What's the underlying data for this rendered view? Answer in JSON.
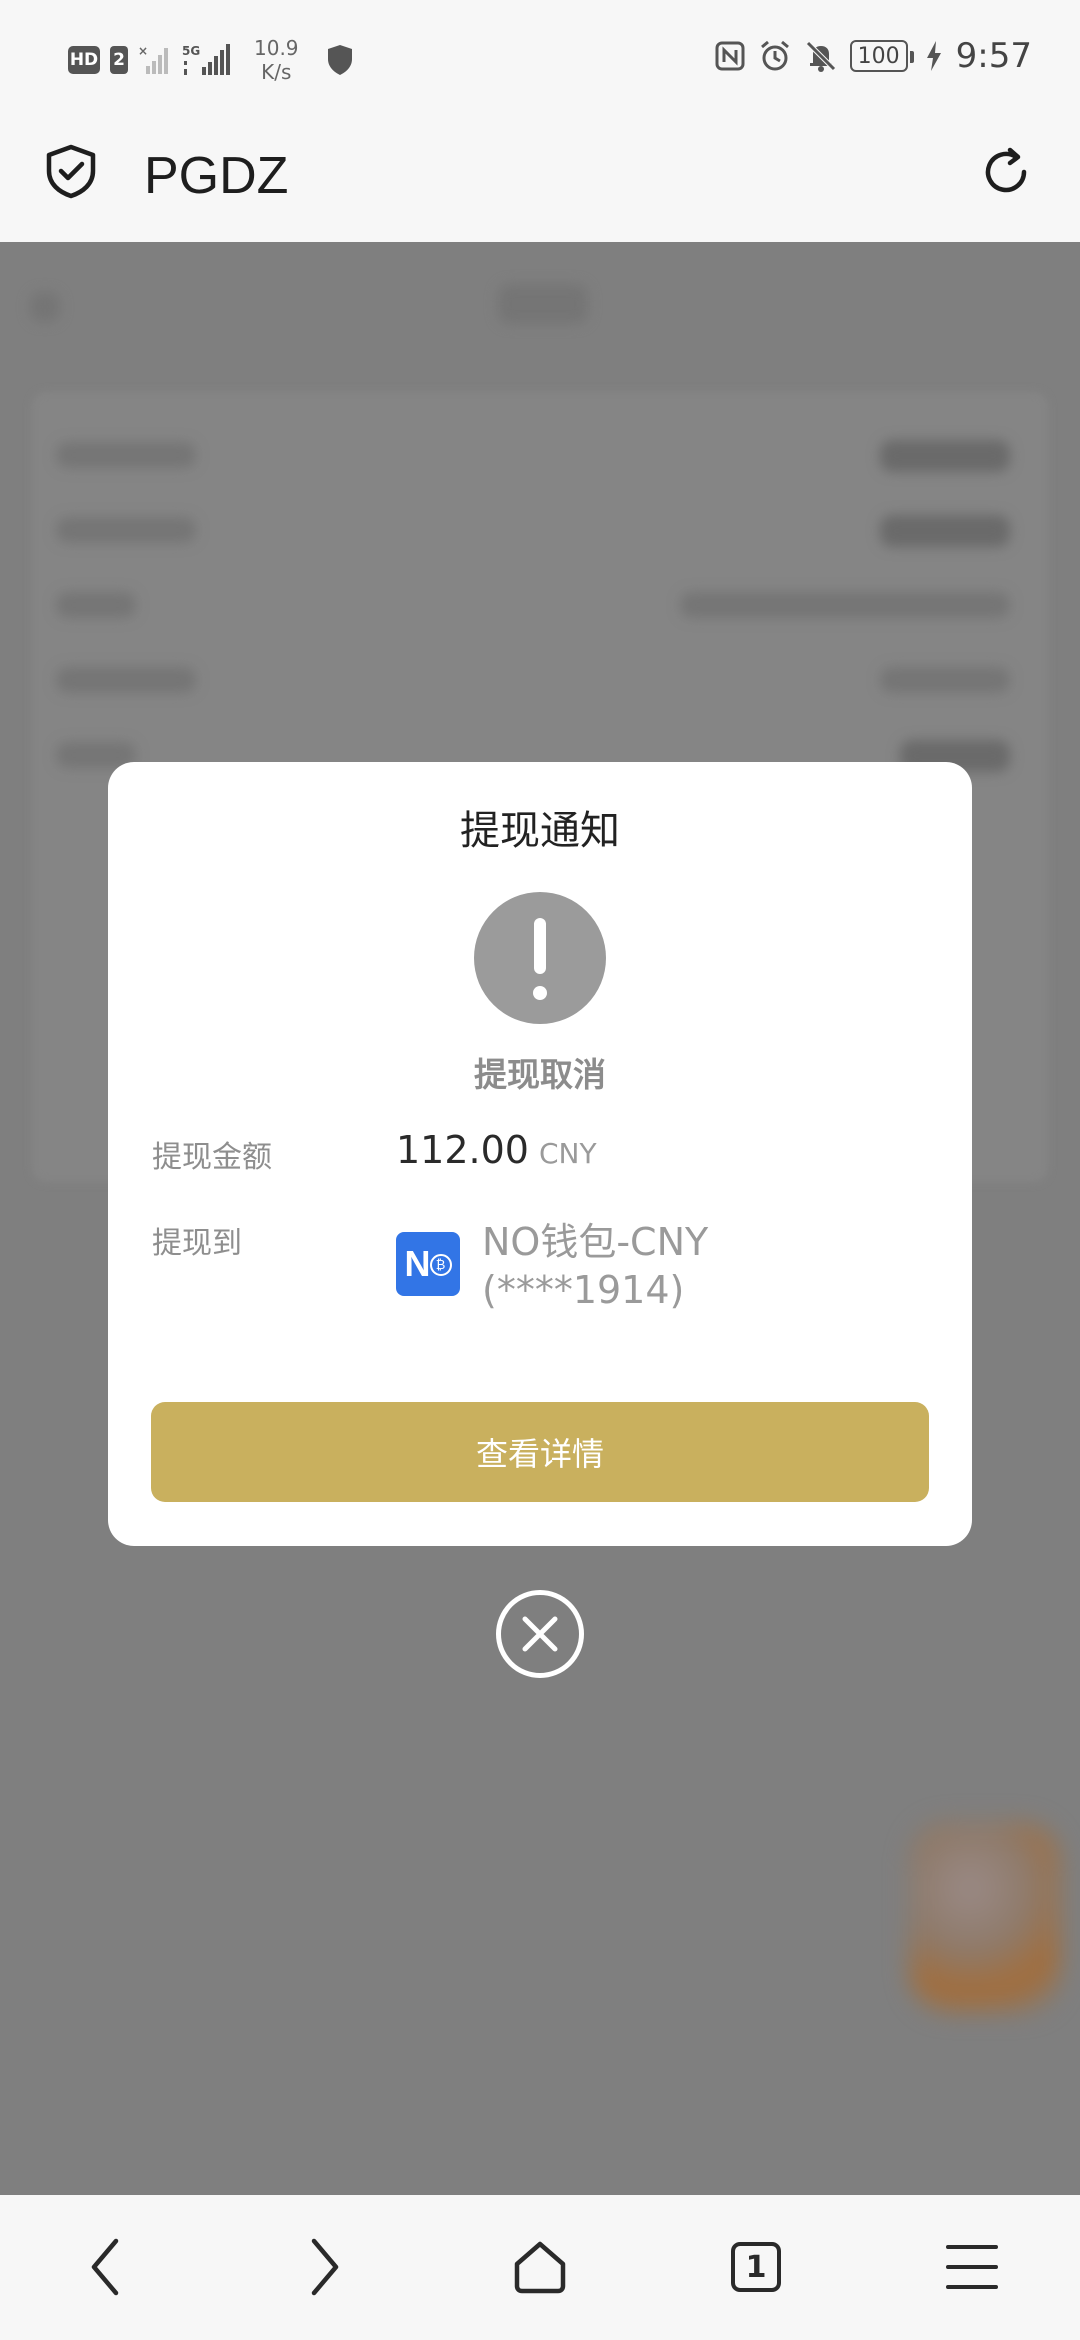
{
  "status_bar": {
    "hd_label": "HD",
    "sim_label": "2",
    "network_tag": "5G",
    "net_speed_value": "10.9",
    "net_speed_unit": "K/s",
    "battery_level": "100",
    "time": "9:57"
  },
  "browser": {
    "site_title": "PGDZ"
  },
  "modal": {
    "title": "提现通知",
    "status_text": "提现取消",
    "amount_label": "提现金额",
    "amount_value": "112.00",
    "amount_currency": "CNY",
    "destination_label": "提现到",
    "wallet_logo_text": "N",
    "wallet_name": "NO钱包-CNY (****1914)",
    "detail_button_label": "查看详情"
  },
  "bottom_nav": {
    "tab_count": "1"
  },
  "colors": {
    "accent_button": "#c9b05e",
    "wallet_blue": "#3275e6",
    "overlay": "#7f7f7f"
  }
}
